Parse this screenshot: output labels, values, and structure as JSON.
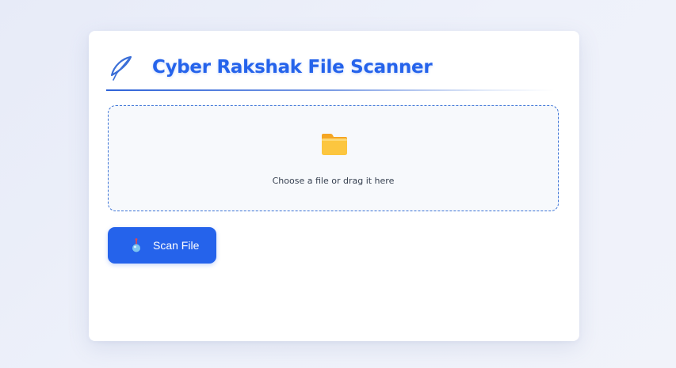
{
  "app": {
    "title": "Cyber Rakshak File Scanner",
    "logo_icon": "feather-quill-icon"
  },
  "upload": {
    "icon": "folder-icon",
    "prompt": "Choose a file or drag it here"
  },
  "actions": {
    "scan_label": "Scan File",
    "scan_icon": "radar-sensor-icon"
  },
  "colors": {
    "accent": "#2563eb",
    "dropzone_border": "#3b73d6",
    "dropzone_bg": "#f7f9fc",
    "folder": "#fbbf24",
    "page_bg": "#e9ecf8"
  }
}
